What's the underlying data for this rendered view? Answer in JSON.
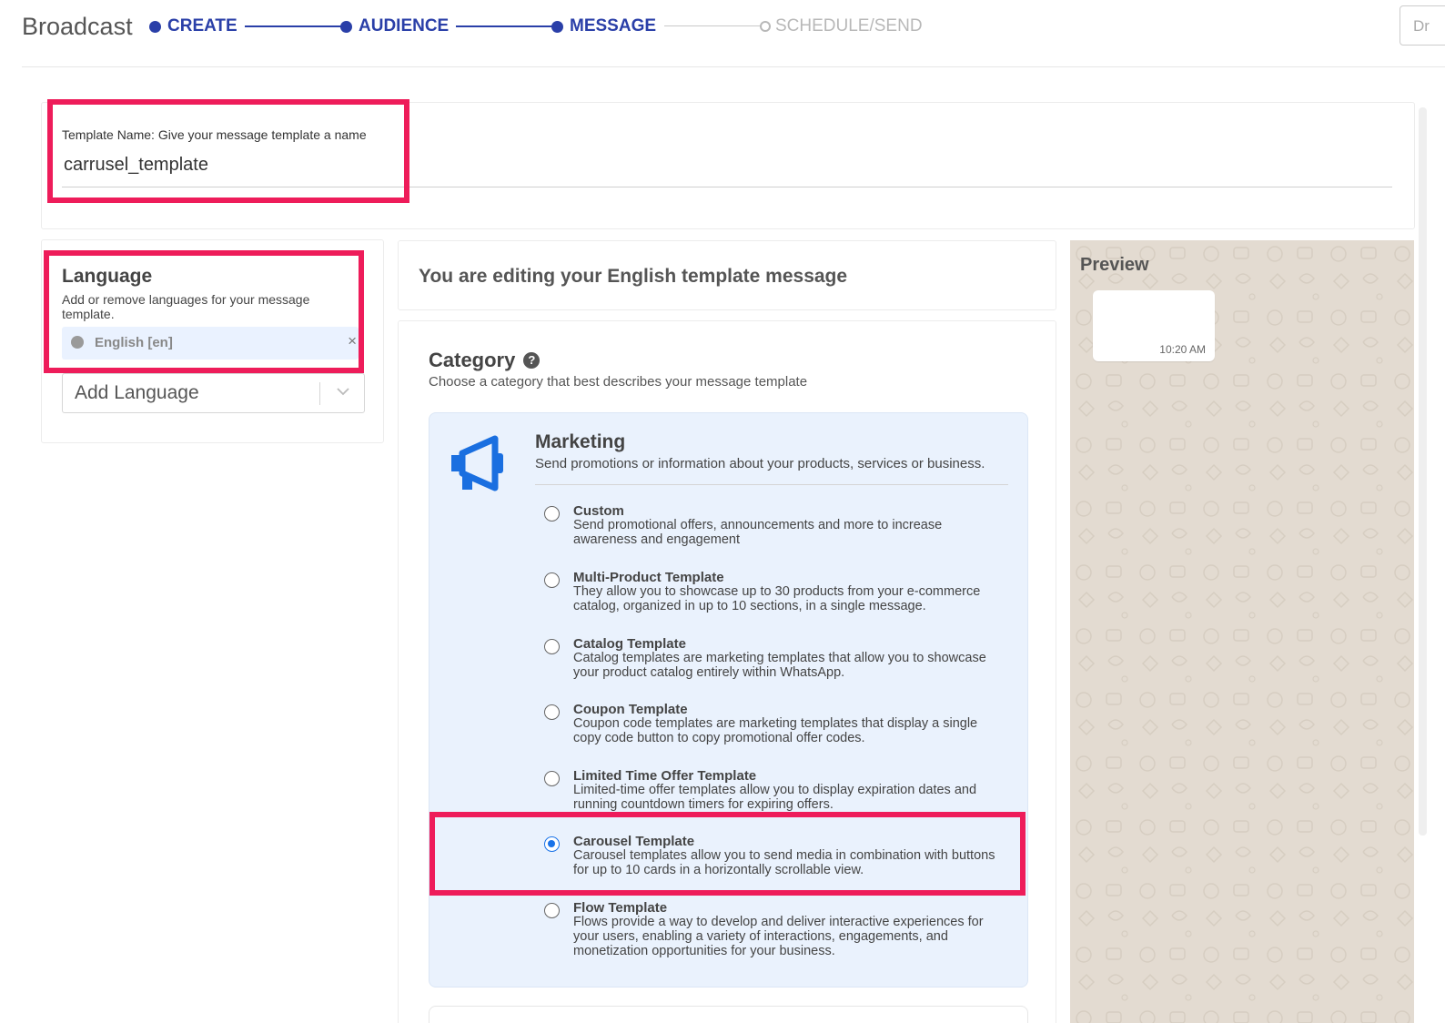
{
  "header": {
    "brand": "Broadcast",
    "steps": [
      {
        "label": "CREATE",
        "state": "done"
      },
      {
        "label": "AUDIENCE",
        "state": "done"
      },
      {
        "label": "MESSAGE",
        "state": "current"
      },
      {
        "label": "SCHEDULE/SEND",
        "state": "pending"
      }
    ],
    "draft_button_label": "Dr"
  },
  "template_name": {
    "label": "Template Name: Give your message template a name",
    "value": "carrusel_template"
  },
  "language": {
    "title": "Language",
    "subtitle": "Add or remove languages for your message template.",
    "selected": "English [en]",
    "remove_icon": "×",
    "add_placeholder": "Add Language"
  },
  "editor": {
    "title": "You are editing your English template message"
  },
  "category": {
    "title": "Category",
    "help_glyph": "?",
    "subtitle": "Choose a category that best describes your message template",
    "marketing": {
      "title": "Marketing",
      "subtitle": "Send promotions or information about your products, services or business.",
      "icon": "megaphone-icon",
      "options": [
        {
          "title": "Custom",
          "desc": "Send promotional offers, announcements and more to increase awareness and engagement",
          "selected": false
        },
        {
          "title": "Multi-Product Template",
          "desc": "They allow you to showcase up to 30 products from your e-commerce catalog, organized in up to 10 sections, in a single message.",
          "selected": false
        },
        {
          "title": "Catalog Template",
          "desc": "Catalog templates are marketing templates that allow you to showcase your product catalog entirely within WhatsApp.",
          "selected": false
        },
        {
          "title": "Coupon Template",
          "desc": "Coupon code templates are marketing templates that display a single copy code button to copy promotional offer codes.",
          "selected": false
        },
        {
          "title": "Limited Time Offer Template",
          "desc": "Limited-time offer templates allow you to display expiration dates and running countdown timers for expiring offers.",
          "selected": false
        },
        {
          "title": "Carousel Template",
          "desc": "Carousel templates allow you to send media in combination with buttons for up to 10 cards in a horizontally scrollable view.",
          "selected": true
        },
        {
          "title": "Flow Template",
          "desc": "Flows provide a way to develop and deliver interactive experiences for your users, enabling a variety of interactions, engagements, and monetization opportunities for your business.",
          "selected": false
        }
      ]
    }
  },
  "preview": {
    "title": "Preview",
    "time": "10:20 AM"
  },
  "colors": {
    "accent": "#2a3fa8",
    "highlight": "#ee1c5a",
    "radio_selected": "#1a73e8",
    "marketing_bg": "#eaf2fd",
    "preview_bg": "#e3dbd1"
  }
}
